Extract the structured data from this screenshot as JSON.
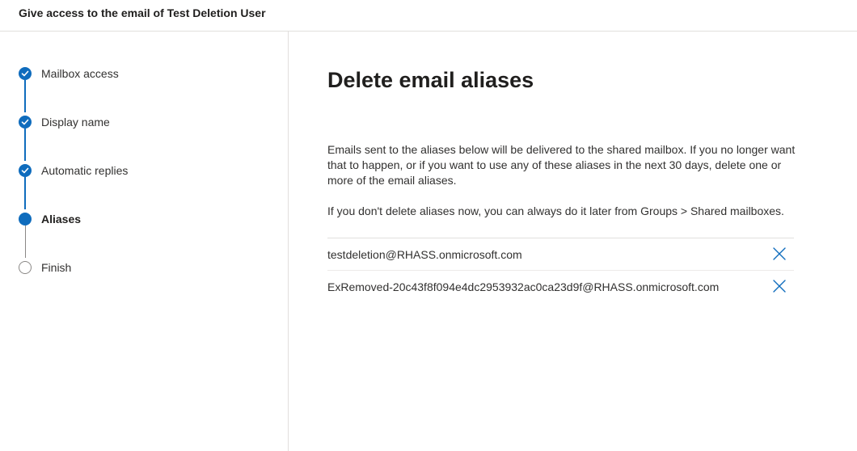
{
  "header": {
    "title": "Give access to the email of Test Deletion User"
  },
  "steps": [
    {
      "label": "Mailbox access",
      "state": "done"
    },
    {
      "label": "Display name",
      "state": "done"
    },
    {
      "label": "Automatic replies",
      "state": "done"
    },
    {
      "label": "Aliases",
      "state": "current"
    },
    {
      "label": "Finish",
      "state": "future"
    }
  ],
  "main": {
    "title": "Delete email aliases",
    "description": "Emails sent to the aliases below will be delivered to the shared mailbox. If you no longer want that to happen, or if you want to use any of these aliases in the next 30 days, delete one or more of the email aliases.",
    "note": "If you don't delete aliases now, you can always do it later from Groups > Shared mailboxes.",
    "aliases": [
      "testdeletion@RHASS.onmicrosoft.com",
      "ExRemoved-20c43f8f094e4dc2953932ac0ca23d9f@RHASS.onmicrosoft.com"
    ]
  },
  "icons": {
    "step_done": "checkmark-icon",
    "remove": "close-icon"
  },
  "colors": {
    "accent": "#0f6cbd",
    "future_step": "#8a8886",
    "text": "#323130"
  }
}
